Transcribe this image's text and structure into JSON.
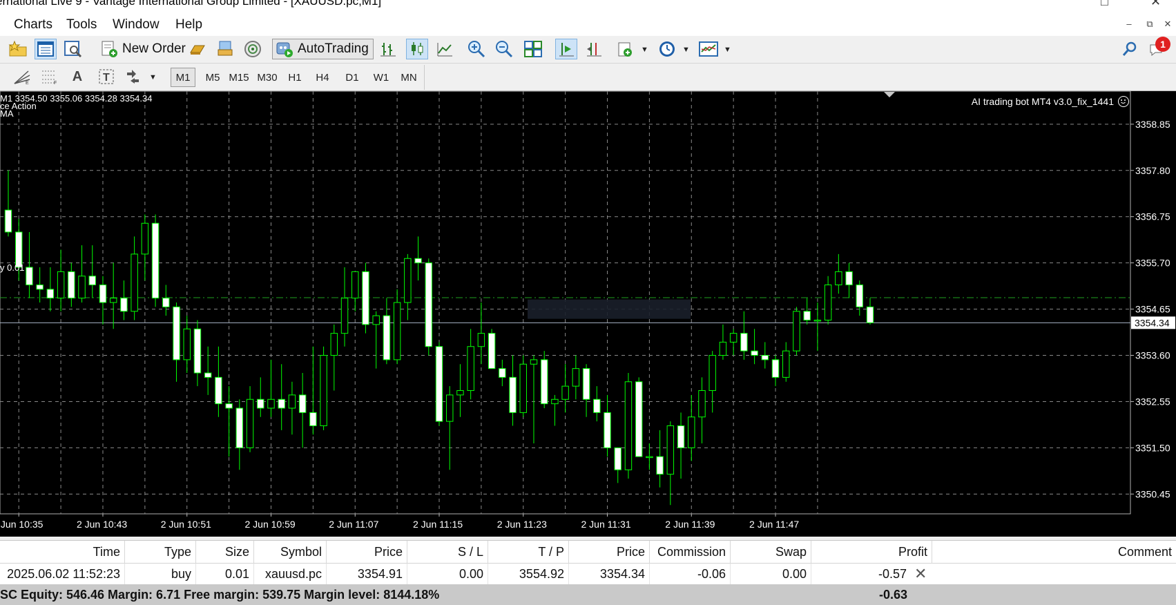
{
  "window": {
    "title": "ernational Live 9 - Vantage International Group Limited - [XAUUSD.pc,M1]"
  },
  "menu": [
    "Charts",
    "Tools",
    "Window",
    "Help"
  ],
  "toolbar": {
    "new_order_label": "New Order",
    "autotrading_label": "AutoTrading",
    "notification_count": "1"
  },
  "timeframes": [
    "M1",
    "M5",
    "M15",
    "M30",
    "H1",
    "H4",
    "D1",
    "W1",
    "MN"
  ],
  "active_timeframe": "M1",
  "chart_header": {
    "ohlc_line": "M1  3354.50 3355.06 3354.28 3354.34",
    "indicator_1": "ce Action",
    "indicator_2": "MA",
    "order_label": "y 0.01",
    "expert_label": "AI trading bot MT4 v3.0_fix_1441"
  },
  "chart_data": {
    "type": "candlestick",
    "symbol": "XAUUSD.pc",
    "timeframe": "M1",
    "y_ticks": [
      "3358.85",
      "3357.80",
      "3356.75",
      "3355.70",
      "3354.65",
      "3353.60",
      "3352.55",
      "3351.50",
      "3350.45"
    ],
    "ylim": [
      3350.0,
      3359.6
    ],
    "current_price": "3354.34",
    "order_price": 3354.91,
    "x_ticks": [
      "2 Jun 10:35",
      "2 Jun 10:43",
      "2 Jun 10:51",
      "2 Jun 10:59",
      "2 Jun 11:07",
      "2 Jun 11:15",
      "2 Jun 11:23",
      "2 Jun 11:31",
      "2 Jun 11:39",
      "2 Jun 11:47"
    ],
    "grid": true,
    "bull_color": "#00ff00",
    "bear_fill": "#ffffff",
    "wick_color": "#00ff00",
    "candles": [
      [
        3356.9,
        3357.8,
        3356.3,
        3356.4
      ],
      [
        3356.4,
        3356.7,
        3355.3,
        3355.6
      ],
      [
        3355.6,
        3356.4,
        3354.9,
        3355.2
      ],
      [
        3355.2,
        3355.6,
        3354.8,
        3355.1
      ],
      [
        3355.1,
        3355.6,
        3354.6,
        3354.9
      ],
      [
        3354.9,
        3356.0,
        3354.6,
        3355.5
      ],
      [
        3355.5,
        3355.7,
        3354.7,
        3354.9
      ],
      [
        3354.9,
        3356.1,
        3354.8,
        3355.4
      ],
      [
        3355.4,
        3356.1,
        3354.9,
        3355.2
      ],
      [
        3355.2,
        3355.4,
        3354.3,
        3354.8
      ],
      [
        3354.8,
        3355.7,
        3354.2,
        3354.9
      ],
      [
        3354.9,
        3355.3,
        3354.4,
        3354.6
      ],
      [
        3354.6,
        3356.3,
        3354.4,
        3355.9
      ],
      [
        3355.9,
        3356.8,
        3355.3,
        3356.6
      ],
      [
        3356.6,
        3356.8,
        3354.7,
        3354.9
      ],
      [
        3354.9,
        3355.2,
        3354.5,
        3354.7
      ],
      [
        3354.7,
        3354.8,
        3353.0,
        3353.5
      ],
      [
        3353.5,
        3354.5,
        3353.2,
        3354.2
      ],
      [
        3354.2,
        3354.4,
        3352.9,
        3353.2
      ],
      [
        3353.2,
        3353.8,
        3352.7,
        3353.1
      ],
      [
        3353.1,
        3353.8,
        3352.2,
        3352.5
      ],
      [
        3352.5,
        3352.9,
        3351.3,
        3352.4
      ],
      [
        3352.4,
        3352.6,
        3351.0,
        3351.5
      ],
      [
        3351.5,
        3352.9,
        3351.4,
        3352.6
      ],
      [
        3352.6,
        3353.1,
        3352.2,
        3352.4
      ],
      [
        3352.4,
        3353.5,
        3352.2,
        3352.6
      ],
      [
        3352.6,
        3353.4,
        3351.9,
        3352.4
      ],
      [
        3352.4,
        3353.0,
        3351.8,
        3352.7
      ],
      [
        3352.7,
        3353.2,
        3351.5,
        3352.3
      ],
      [
        3352.3,
        3353.8,
        3351.8,
        3352.0
      ],
      [
        3352.0,
        3353.8,
        3351.9,
        3353.6
      ],
      [
        3353.6,
        3354.3,
        3352.8,
        3354.1
      ],
      [
        3354.1,
        3355.6,
        3353.8,
        3354.9
      ],
      [
        3354.9,
        3355.5,
        3354.6,
        3355.5
      ],
      [
        3355.5,
        3355.7,
        3354.1,
        3354.3
      ],
      [
        3354.3,
        3354.6,
        3353.3,
        3354.5
      ],
      [
        3354.5,
        3354.9,
        3353.4,
        3353.5
      ],
      [
        3353.5,
        3355.1,
        3353.4,
        3354.8
      ],
      [
        3354.8,
        3355.9,
        3354.4,
        3355.8
      ],
      [
        3355.8,
        3356.3,
        3355.3,
        3355.7
      ],
      [
        3355.7,
        3355.8,
        3353.6,
        3353.8
      ],
      [
        3353.8,
        3353.9,
        3352.0,
        3352.1
      ],
      [
        3352.1,
        3352.9,
        3351.0,
        3352.7
      ],
      [
        3352.7,
        3353.4,
        3352.2,
        3352.8
      ],
      [
        3352.8,
        3354.2,
        3352.6,
        3353.8
      ],
      [
        3353.8,
        3354.8,
        3353.4,
        3354.1
      ],
      [
        3354.1,
        3354.2,
        3353.3,
        3353.3
      ],
      [
        3353.3,
        3353.5,
        3352.9,
        3353.1
      ],
      [
        3353.1,
        3353.6,
        3352.0,
        3352.3
      ],
      [
        3352.3,
        3353.6,
        3352.2,
        3353.4
      ],
      [
        3353.4,
        3353.6,
        3351.6,
        3353.5
      ],
      [
        3353.5,
        3353.7,
        3352.4,
        3352.5
      ],
      [
        3352.5,
        3352.7,
        3352.0,
        3352.6
      ],
      [
        3352.6,
        3353.4,
        3352.3,
        3352.9
      ],
      [
        3352.9,
        3353.6,
        3352.6,
        3353.3
      ],
      [
        3353.3,
        3353.4,
        3352.2,
        3352.6
      ],
      [
        3352.6,
        3352.9,
        3352.1,
        3352.3
      ],
      [
        3352.3,
        3352.7,
        3351.3,
        3351.5
      ],
      [
        3351.5,
        3351.5,
        3350.7,
        3351.0
      ],
      [
        3351.0,
        3353.2,
        3350.8,
        3353.0
      ],
      [
        3353.0,
        3353.1,
        3351.3,
        3351.3
      ],
      [
        3351.3,
        3351.6,
        3351.0,
        3351.3
      ],
      [
        3351.3,
        3351.9,
        3350.6,
        3350.9
      ],
      [
        3350.9,
        3352.1,
        3350.2,
        3352.0
      ],
      [
        3352.0,
        3352.3,
        3350.8,
        3351.5
      ],
      [
        3351.5,
        3352.7,
        3351.2,
        3352.2
      ],
      [
        3352.2,
        3353.1,
        3351.6,
        3352.8
      ],
      [
        3352.8,
        3353.7,
        3352.3,
        3353.6
      ],
      [
        3353.6,
        3354.3,
        3353.5,
        3353.9
      ],
      [
        3353.9,
        3354.2,
        3353.6,
        3354.1
      ],
      [
        3354.1,
        3354.6,
        3353.5,
        3353.7
      ],
      [
        3353.7,
        3354.2,
        3353.4,
        3353.6
      ],
      [
        3353.6,
        3353.9,
        3353.3,
        3353.5
      ],
      [
        3353.5,
        3353.6,
        3352.9,
        3353.1
      ],
      [
        3353.1,
        3353.9,
        3353.0,
        3353.7
      ],
      [
        3353.7,
        3354.7,
        3353.6,
        3354.6
      ],
      [
        3354.6,
        3354.9,
        3354.3,
        3354.4
      ],
      [
        3354.4,
        3354.8,
        3353.7,
        3354.4
      ],
      [
        3354.4,
        3355.4,
        3354.3,
        3355.2
      ],
      [
        3355.2,
        3355.9,
        3355.0,
        3355.5
      ],
      [
        3355.5,
        3355.7,
        3354.9,
        3355.2
      ],
      [
        3355.2,
        3355.3,
        3354.5,
        3354.7
      ],
      [
        3354.7,
        3354.9,
        3354.3,
        3354.34
      ]
    ]
  },
  "terminal": {
    "columns": [
      "Time",
      "Type",
      "Size",
      "Symbol",
      "Price",
      "S / L",
      "T / P",
      "Price",
      "Commission",
      "Swap",
      "Profit",
      "Comment"
    ],
    "row": [
      "2025.06.02 11:52:23",
      "buy",
      "0.01",
      "xauusd.pc",
      "3354.91",
      "0.00",
      "3554.92",
      "3354.34",
      "-0.06",
      "0.00",
      "-0.57",
      ""
    ],
    "summary": "SC  Equity: 546.46  Margin: 6.71  Free margin: 539.75  Margin level: 8144.18%",
    "summary_profit": "-0.63"
  }
}
